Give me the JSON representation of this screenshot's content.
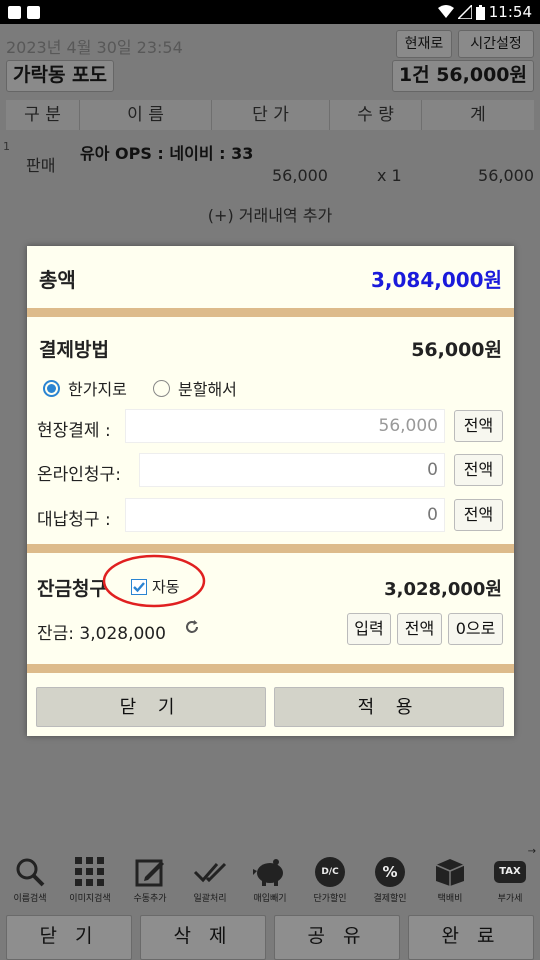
{
  "status_bar": {
    "time": "11:54"
  },
  "header": {
    "date": "2023년 4월 30일 23:54",
    "now_button": "현재로",
    "time_setting_button": "시간설정",
    "store_name": "가락동 포도",
    "summary": "1건 56,000원"
  },
  "table": {
    "columns": [
      "구 분",
      "이 름",
      "단 가",
      "수 량",
      "계"
    ],
    "rows": [
      {
        "index": "1",
        "type": "판매",
        "name": "유아 OPS : 네이비 : 33",
        "price": "56,000",
        "qty": "x 1",
        "total": "56,000"
      }
    ],
    "add_row": "(+) 거래내역 추가"
  },
  "modal": {
    "total_label": "총액",
    "total_value": "3,084,000원",
    "payment_label": "결제방법",
    "payment_value": "56,000원",
    "radio_single": "한가지로",
    "radio_split": "분할해서",
    "onsite_label": "현장결제 :",
    "onsite_value": "56,000",
    "online_label": "온라인청구:",
    "online_value": "0",
    "proxy_label": "대납청구 :",
    "proxy_value": "0",
    "full_amount_button": "전액",
    "balance_label": "잔금청구",
    "auto_label": "자동",
    "balance_value": "3,028,000원",
    "remaining_text": "잔금: 3,028,000",
    "input_button": "입력",
    "all_button": "전액",
    "zero_button": "0으로",
    "close_button": "닫 기",
    "apply_button": "적 용"
  },
  "toolbar": {
    "items": [
      {
        "label": "이름검색",
        "icon": "search-icon"
      },
      {
        "label": "이미지검색",
        "icon": "grid-icon"
      },
      {
        "label": "수동추가",
        "icon": "edit-icon"
      },
      {
        "label": "일괄처리",
        "icon": "double-check-icon"
      },
      {
        "label": "매입빼기",
        "icon": "piggy-bank-icon"
      },
      {
        "label": "단가할인",
        "icon": "dc-icon"
      },
      {
        "label": "결제할인",
        "icon": "percent-icon"
      },
      {
        "label": "택배비",
        "icon": "box-icon"
      },
      {
        "label": "부가세",
        "icon": "tax-icon"
      }
    ],
    "dc_text": "D/C",
    "percent_text": "%",
    "tax_text": "TAX"
  },
  "bottom_buttons": [
    "닫 기",
    "삭 제",
    "공 유",
    "완 료"
  ],
  "colors": {
    "total_value": "#1a1adb",
    "separator": "#ddbb8b",
    "modal_bg": "#fffff0",
    "annotation_circle": "#e02020"
  }
}
